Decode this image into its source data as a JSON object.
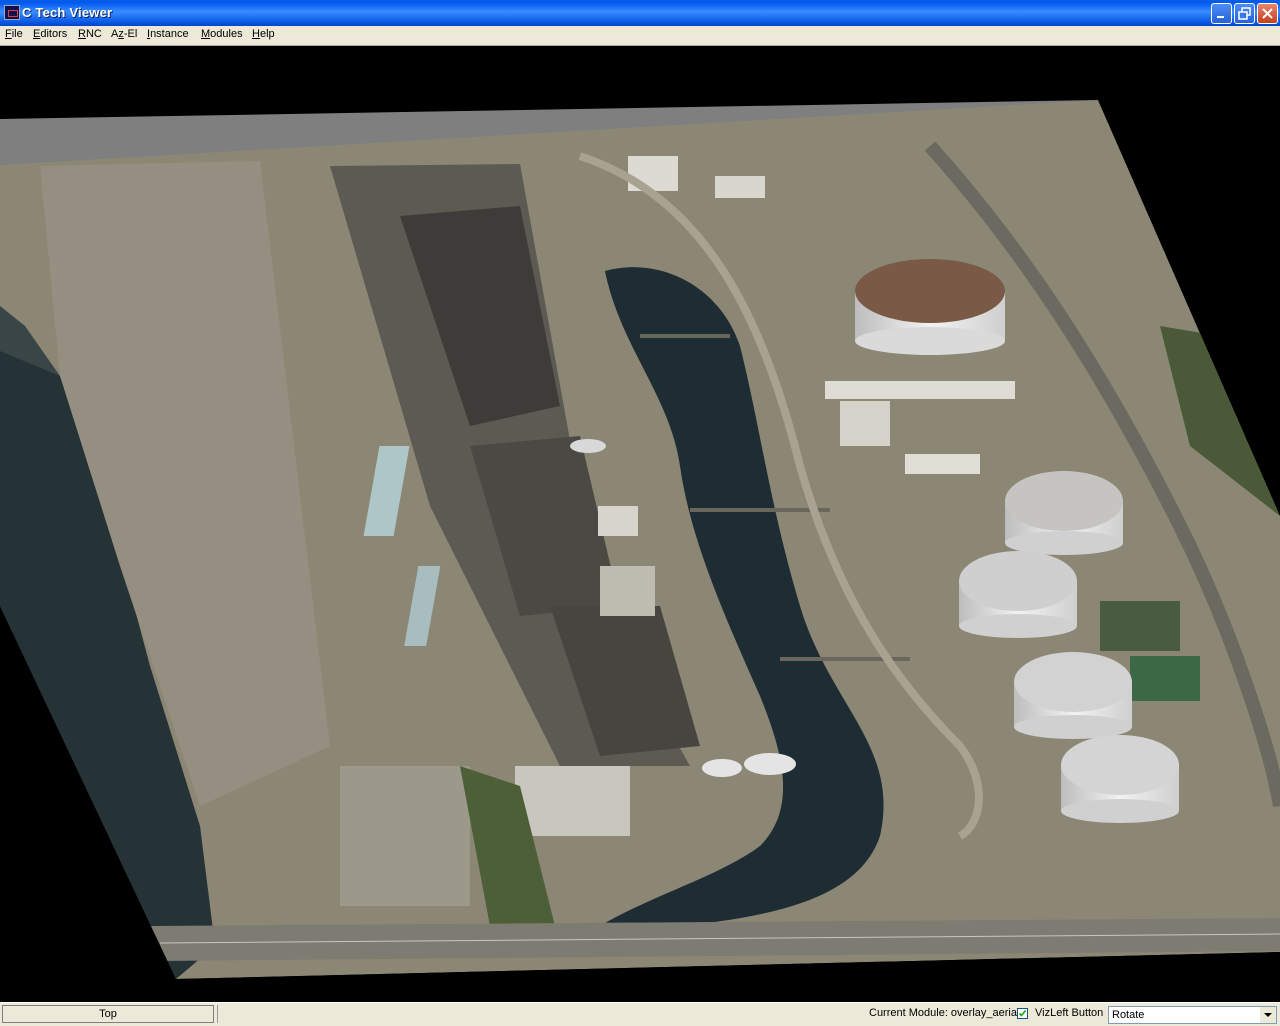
{
  "window": {
    "title": "C Tech Viewer"
  },
  "menu": {
    "file_prefix": "",
    "file_u": "F",
    "file_rest": "ile",
    "editors_u": "E",
    "editors_rest": "ditors",
    "rnc_u": "R",
    "rnc_rest": "NC",
    "azel_prefix": "A",
    "azel_u": "z",
    "azel_rest": "-El",
    "instance_u": "I",
    "instance_rest": "nstance",
    "modules_u": "M",
    "modules_rest": "odules",
    "help_u": "H",
    "help_rest": "elp"
  },
  "statusbar": {
    "view_button": "Top",
    "current_module": "Current Module: overlay_aerial",
    "checkbox_checked": true,
    "vizleft_label": "VizLeft Button",
    "mode_select": "Rotate"
  },
  "colors": {
    "title_blue": "#0058EE",
    "viewport_bg": "#000000",
    "plane_edge": "#7F7F7F",
    "ground": "#8C8775",
    "water": "#1E2C33",
    "tank_white": "#E3E3E3",
    "tank_rusty": "#7A5A46"
  }
}
